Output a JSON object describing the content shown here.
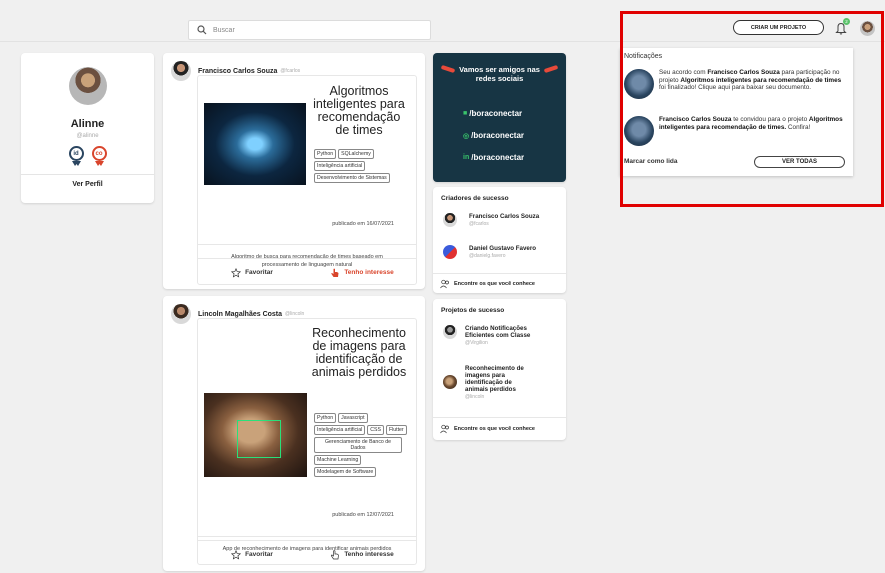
{
  "header": {
    "search_placeholder": "Buscar",
    "create_project_label": "CRIAR UM PROJETO",
    "notification_count": "2"
  },
  "profile": {
    "name": "Alinne",
    "handle": "@alinne",
    "badges": [
      "id",
      "co"
    ],
    "view_profile_label": "Ver Perfil"
  },
  "posts": [
    {
      "author": "Francisco Carlos Souza",
      "handle": "@fcarlos",
      "title": "Algoritmos inteligentes para recomendação de times",
      "tags": [
        "Python",
        "SQLalchemy",
        "Inteligência artificial",
        "Desenvolvimento de Sistemas"
      ],
      "published": "publicado em 16/07/2021",
      "description": "Algoritmo de busca para recomendação de times baseado em processamento de linguagem natural",
      "favorite_label": "Favoritar",
      "interest_label": "Tenho interesse"
    },
    {
      "author": "Lincoln Magalhães Costa",
      "handle": "@lincoln",
      "title": "Reconhecimento de imagens para identificação de animais perdidos",
      "tags": [
        "Python",
        "Javascript",
        "Inteligência artificial",
        "CSS",
        "Flutter",
        "Gerenciamento de Banco de Dados",
        "Machine Learning",
        "Modelagem de Software"
      ],
      "published": "publicado em 12/07/2021",
      "description": "App de reconhecimento de imagens para identificar animais perdidos",
      "favorite_label": "Favoritar",
      "interest_label": "Tenho interesse"
    }
  ],
  "social": {
    "title": "Vamos ser amigos nas redes sociais",
    "links": [
      {
        "icon": "facebook-icon",
        "label": "/boraconectar"
      },
      {
        "icon": "instagram-icon",
        "label": "/boraconectar"
      },
      {
        "icon": "linkedin-icon",
        "label": "/boraconectar"
      }
    ],
    "accent": "#e84a3a",
    "background": "#173544"
  },
  "creators": {
    "title": "Criadores de sucesso",
    "items": [
      {
        "name": "Francisco Carlos Souza",
        "handle": "@fcarlos"
      },
      {
        "name": "Daniel Gustavo Favero",
        "handle": "@danielg.favero"
      }
    ],
    "find_label": "Encontre os que você conhece"
  },
  "projects": {
    "title": "Projetos de sucesso",
    "items": [
      {
        "name": "Criando Notificações Eficientes com Classe",
        "handle": "@Virgilion"
      },
      {
        "name": "Reconhecimento de imagens para identificação de animais perdidos",
        "handle": "@lincoln"
      }
    ],
    "find_label": "Encontre os que você conhece"
  },
  "notifications": {
    "title": "Notificações",
    "items": [
      {
        "pre": "Seu acordo com ",
        "b1": "Francisco Carlos Souza",
        "mid": " para participação no projeto ",
        "b2": "Algoritmos inteligentes para recomendação de times",
        "post": " foi finalizado! Clique aqui para baixar seu documento."
      },
      {
        "pre": "",
        "b1": "Francisco Carlos Souza",
        "mid": " te convidou para o projeto ",
        "b2": "Algoritmos inteligentes para recomendação de times.",
        "post": " Confira!"
      }
    ],
    "mark_read_label": "Marcar como lida",
    "see_all_label": "VER TODAS"
  },
  "highlight_color": "#e00000"
}
